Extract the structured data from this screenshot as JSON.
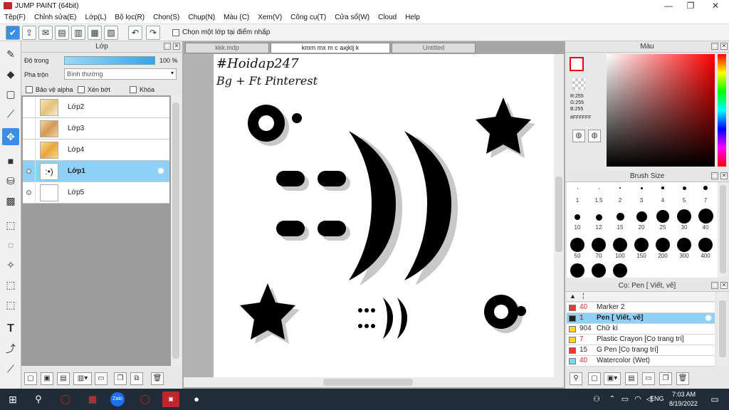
{
  "window": {
    "title": "JUMP PAINT (64bit)",
    "minimize": "—",
    "maximize": "❐",
    "close": "✕"
  },
  "menu": [
    "Tệp(F)",
    "Chỉnh sửa(E)",
    "Lớp(L)",
    "Bộ lọc(R)",
    "Chọn(S)",
    "Chụp(N)",
    "Màu (C)",
    "Xem(V)",
    "Công cụ(T)",
    "Cửa sổ(W)",
    "Cloud",
    "Help"
  ],
  "toolbar": {
    "select_one_layer_label": "Chọn một lớp tại điểm nhấp"
  },
  "layer_panel": {
    "title": "Lớp",
    "opacity_label": "Độ trong",
    "opacity_value": "100 %",
    "blend_label": "Pha trộn",
    "blend_value": "Bình thường",
    "protect_alpha": "Bảo vệ alpha",
    "clip": "Xén bớt",
    "lock": "Khóa",
    "layers": [
      {
        "name": "Lớp2"
      },
      {
        "name": "Lớp3"
      },
      {
        "name": "Lớp4"
      },
      {
        "name": "Lớp1"
      },
      {
        "name": "Lớp5"
      }
    ]
  },
  "doc_tabs": [
    "kkk.mdp",
    "kmm mx m c axjklj k ácldksclkicsosckInksk.mdp",
    "Untitled"
  ],
  "canvas": {
    "text_lines": [
      "#Hoidap247",
      "Bg + Ft Pinterest"
    ]
  },
  "color_panel": {
    "title": "Màu",
    "r": "R:255",
    "g": "G:255",
    "b": "B:255",
    "hex": "#FFFFFF"
  },
  "brush_size_panel": {
    "title": "Brush Size",
    "sizes": [
      "1",
      "1.5",
      "2",
      "3",
      "4",
      "5",
      "7",
      "10",
      "12",
      "15",
      "20",
      "25",
      "30",
      "40",
      "50",
      "70",
      "100",
      "150",
      "200",
      "300",
      "400"
    ]
  },
  "brush_panel": {
    "title": "Cọ: Pen [ Viết, vẽ]",
    "brushes": [
      {
        "size": "40",
        "name": "Marker 2",
        "color": "#e8393a"
      },
      {
        "size": "1",
        "name": "Pen [ Viết, vẽ]",
        "color": "#222222"
      },
      {
        "size": "904",
        "name": "Chữ kí",
        "color": "#f2d82a"
      },
      {
        "size": "7",
        "name": "Plastic Crayon [Cọ trang trí]",
        "color": "#f2d82a"
      },
      {
        "size": "15",
        "name": "G Pen [Cọ trang trí]",
        "color": "#e8393a"
      },
      {
        "size": "40",
        "name": "Watercolor (Wet)",
        "color": "#7fd4f0"
      }
    ]
  },
  "taskbar": {
    "time": "7:03 AM",
    "date": "8/19/2022",
    "lang": "ENG"
  }
}
